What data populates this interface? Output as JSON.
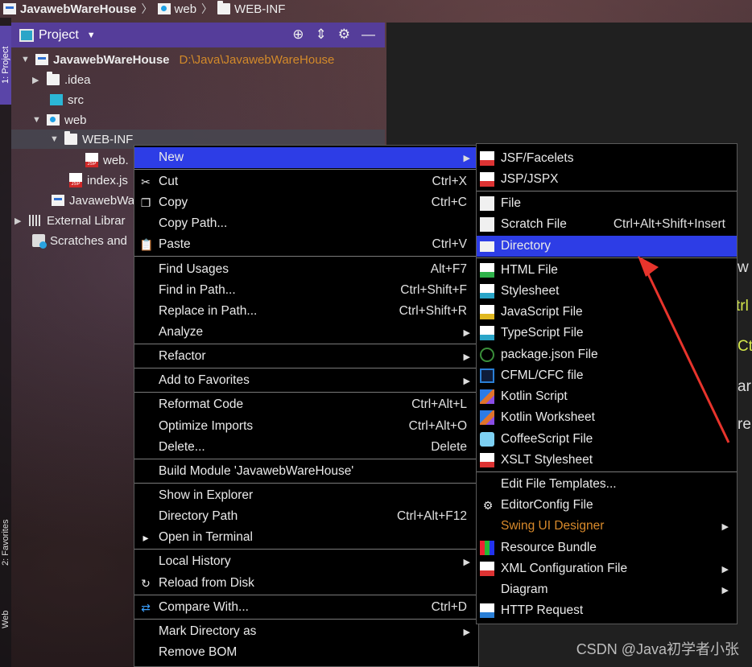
{
  "breadcrumb": [
    "JavawebWareHouse",
    "web",
    "WEB-INF"
  ],
  "stripe": {
    "project_tab": "1: Project",
    "favorites_tab": "2: Favorites",
    "web_tab": "Web"
  },
  "project_panel": {
    "title": "Project"
  },
  "tree": {
    "root": {
      "label": "JavawebWareHouse",
      "path": "D:\\Java\\JavawebWareHouse"
    },
    "idea": ".idea",
    "src": "src",
    "web": "web",
    "webinf": "WEB-INF",
    "webxml": "web.",
    "indexjsp": "index.js",
    "iml": "JavawebWa",
    "ext": "External Librar",
    "scratch": "Scratches and"
  },
  "context_menu": {
    "new": "New",
    "cut": "Cut",
    "cut_sc": "Ctrl+X",
    "copy": "Copy",
    "copy_sc": "Ctrl+C",
    "copy_path": "Copy Path...",
    "paste": "Paste",
    "paste_sc": "Ctrl+V",
    "find_usages": "Find Usages",
    "find_usages_sc": "Alt+F7",
    "find_in_path": "Find in Path...",
    "find_in_path_sc": "Ctrl+Shift+F",
    "replace_in_path": "Replace in Path...",
    "replace_in_path_sc": "Ctrl+Shift+R",
    "analyze": "Analyze",
    "refactor": "Refactor",
    "add_favorites": "Add to Favorites",
    "reformat": "Reformat Code",
    "reformat_sc": "Ctrl+Alt+L",
    "optimize": "Optimize Imports",
    "optimize_sc": "Ctrl+Alt+O",
    "delete": "Delete...",
    "delete_sc": "Delete",
    "build_module": "Build Module 'JavawebWareHouse'",
    "show_explorer": "Show in Explorer",
    "directory_path": "Directory Path",
    "directory_path_sc": "Ctrl+Alt+F12",
    "open_terminal": "Open in Terminal",
    "local_history": "Local History",
    "reload": "Reload from Disk",
    "compare": "Compare With...",
    "compare_sc": "Ctrl+D",
    "mark_dir": "Mark Directory as",
    "remove_bom": "Remove BOM"
  },
  "new_submenu": {
    "jsf": "JSF/Facelets",
    "jsp": "JSP/JSPX",
    "file": "File",
    "scratch": "Scratch File",
    "scratch_sc": "Ctrl+Alt+Shift+Insert",
    "directory": "Directory",
    "html": "HTML File",
    "stylesheet": "Stylesheet",
    "javascript": "JavaScript File",
    "typescript": "TypeScript File",
    "package_json": "package.json File",
    "cfml": "CFML/CFC file",
    "kotlin_script": "Kotlin Script",
    "kotlin_worksheet": "Kotlin Worksheet",
    "coffeescript": "CoffeeScript File",
    "xslt": "XSLT Stylesheet",
    "edit_templates": "Edit File Templates...",
    "editorconfig": "EditorConfig File",
    "swing": "Swing UI Designer",
    "resource_bundle": "Resource Bundle",
    "xml_config": "XML Configuration File",
    "diagram": "Diagram",
    "http_request": "HTTP Request"
  },
  "editor_fragments": [
    "w",
    "trl",
    "Ct",
    "ar",
    "re"
  ],
  "watermark": "CSDN @Java初学者小张",
  "colors": {
    "highlight": "#2d3de6",
    "project_header": "#553d9a",
    "path_orange": "#d38a2a",
    "arrow_red": "#e8342c"
  }
}
